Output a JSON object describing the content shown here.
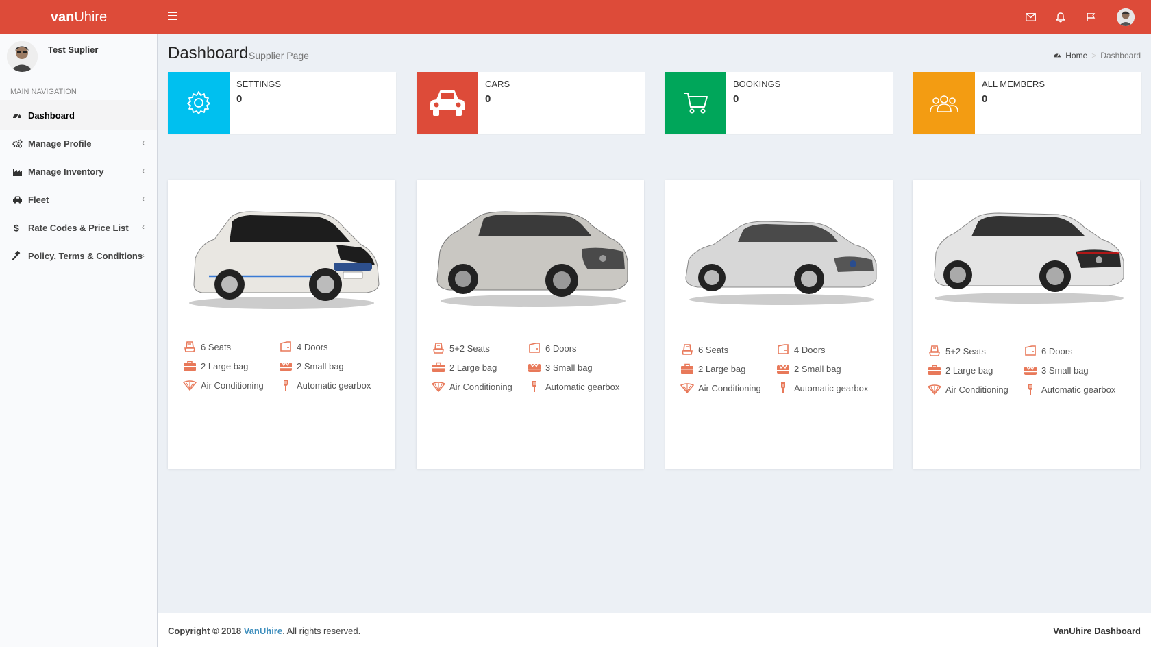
{
  "app": {
    "logo_bold": "van",
    "logo_rest": "Uhire"
  },
  "user": {
    "name": "Test Suplier"
  },
  "sidebar": {
    "header": "MAIN NAVIGATION",
    "items": [
      {
        "label": "Dashboard",
        "icon": "dashboard-icon",
        "active": true
      },
      {
        "label": "Manage Profile",
        "icon": "cogs-icon"
      },
      {
        "label": "Manage Inventory",
        "icon": "factory-icon"
      },
      {
        "label": "Fleet",
        "icon": "car-icon"
      },
      {
        "label": "Rate Codes & Price List",
        "icon": "dollar-icon"
      },
      {
        "label": "Policy, Terms & Conditions",
        "icon": "gavel-icon"
      }
    ],
    "chevron": "‹"
  },
  "page": {
    "title": "Dashboard",
    "subtitle": "Supplier Page"
  },
  "breadcrumb": {
    "home": "Home",
    "sep": ">",
    "current": "Dashboard"
  },
  "info_boxes": [
    {
      "label": "SETTINGS",
      "value": "0",
      "color": "#00c0ef",
      "icon": "gear-icon"
    },
    {
      "label": "CARS",
      "value": "0",
      "color": "#dd4b39",
      "icon": "car-icon"
    },
    {
      "label": "BOOKINGS",
      "value": "0",
      "color": "#00a65a",
      "icon": "cart-icon"
    },
    {
      "label": "ALL MEMBERS",
      "value": "0",
      "color": "#f39c12",
      "icon": "users-icon"
    }
  ],
  "cars": [
    {
      "seats": "6 Seats",
      "doors": "4 Doors",
      "large": "2 Large bag",
      "small": "2 Small bag",
      "ac": "Air Conditioning",
      "gear": "Automatic gearbox"
    },
    {
      "seats": "5+2 Seats",
      "doors": "6 Doors",
      "large": "2 Large bag",
      "small": "3 Small bag",
      "ac": "Air Conditioning",
      "gear": "Automatic gearbox"
    },
    {
      "seats": "6 Seats",
      "doors": "4 Doors",
      "large": "2 Large bag",
      "small": "2 Small bag",
      "ac": "Air Conditioning",
      "gear": "Automatic gearbox"
    },
    {
      "seats": "5+2 Seats",
      "doors": "6 Doors",
      "large": "2 Large bag",
      "small": "3 Small bag",
      "ac": "Air Conditioning",
      "gear": "Automatic gearbox"
    }
  ],
  "footer": {
    "copyright": "Copyright © 2018",
    "brand": "VanUhire",
    "rights": ". All rights reserved.",
    "right_text": "VanUhire Dashboard"
  },
  "colors": {
    "accent": "#dd4b39",
    "feature_icon": "#e8795a"
  }
}
